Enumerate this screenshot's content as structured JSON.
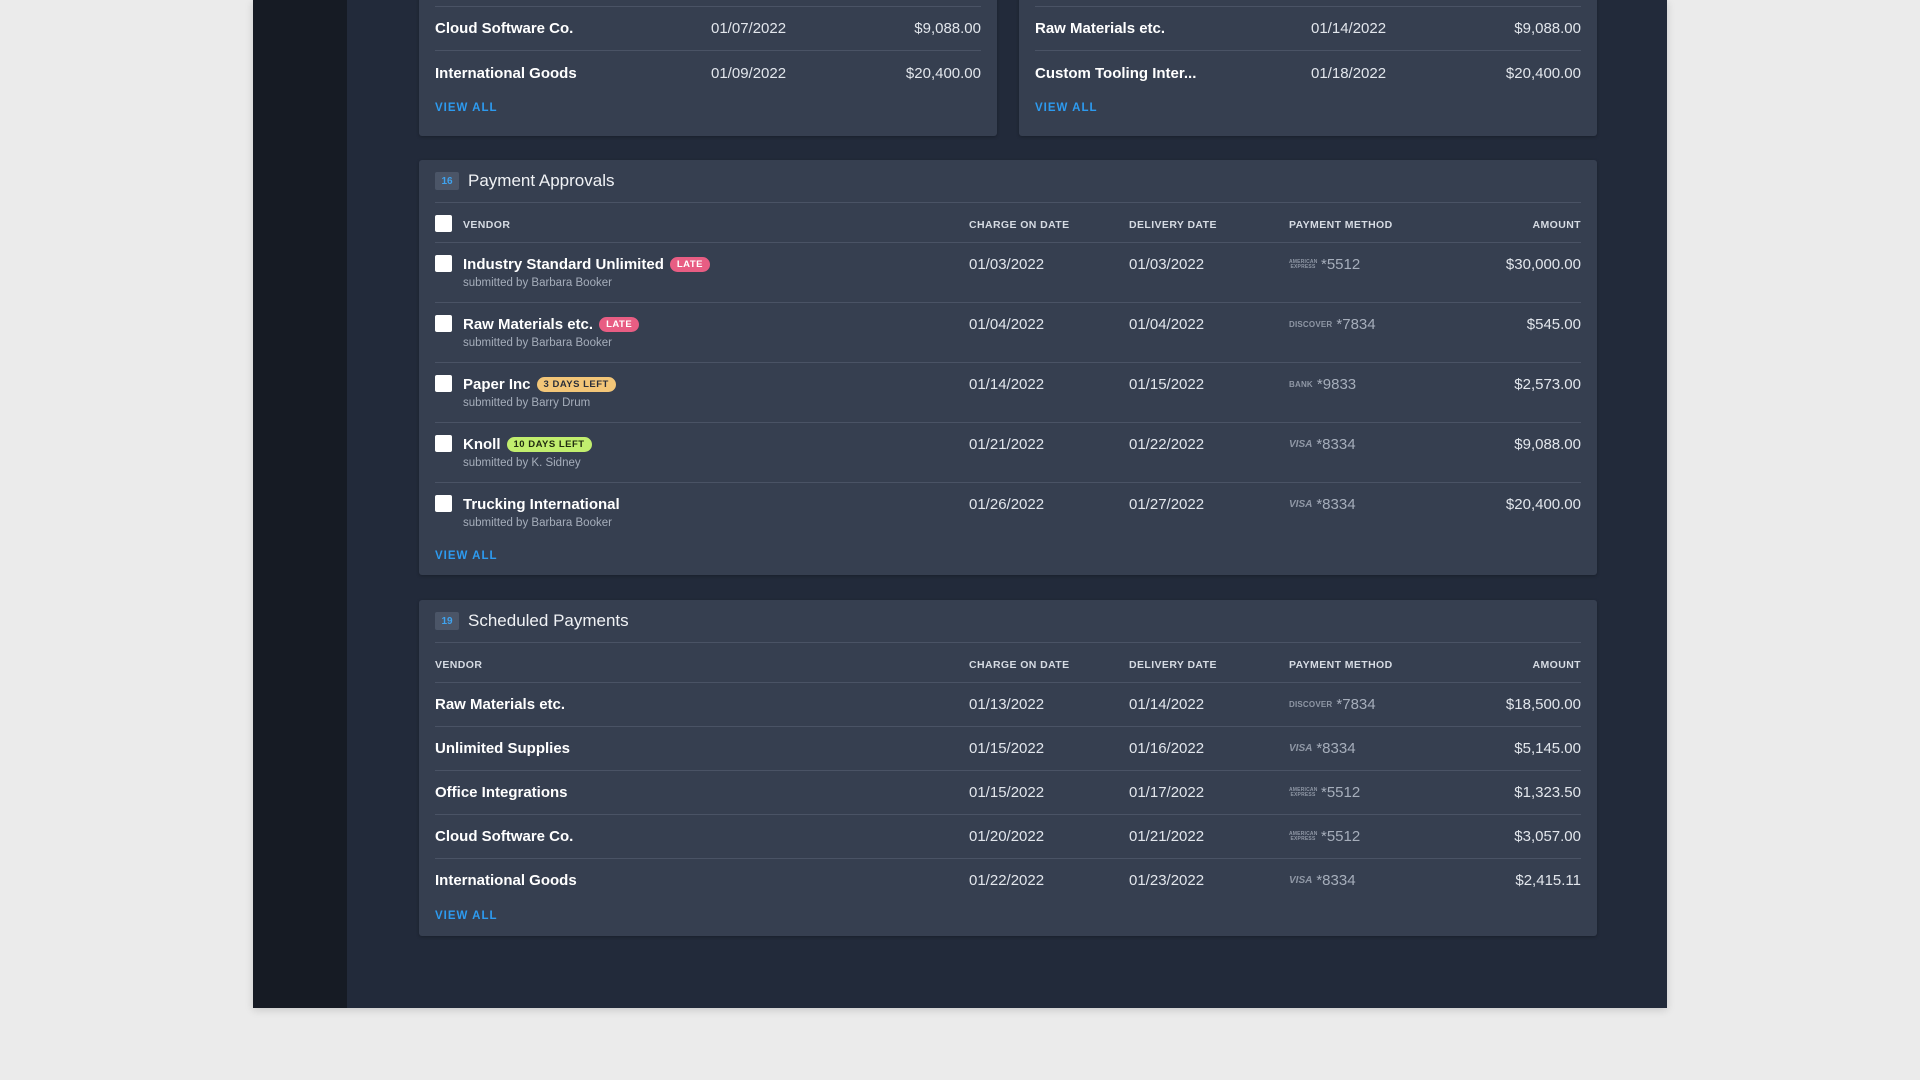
{
  "top_left_card": {
    "rows": [
      {
        "vendor": "Cloud Software Co.",
        "date": "01/07/2022",
        "amount": "$9,088.00"
      },
      {
        "vendor": "International Goods",
        "date": "01/09/2022",
        "amount": "$20,400.00"
      }
    ],
    "view_all": "VIEW ALL"
  },
  "top_right_card": {
    "rows": [
      {
        "vendor": "Raw Materials etc.",
        "date": "01/14/2022",
        "amount": "$9,088.00"
      },
      {
        "vendor": "Custom Tooling Inter...",
        "date": "01/18/2022",
        "amount": "$20,400.00"
      }
    ],
    "view_all": "VIEW ALL"
  },
  "payment_approvals": {
    "count": "16",
    "title": "Payment Approvals",
    "columns": {
      "vendor": "VENDOR",
      "charge_on_date": "CHARGE ON DATE",
      "delivery_date": "DELIVERY DATE",
      "payment_method": "PAYMENT METHOD",
      "amount": "AMOUNT"
    },
    "rows": [
      {
        "vendor": "Industry Standard Unlimited",
        "tag": "LATE",
        "tag_type": "late",
        "submitted_by": "submitted by Barbara Booker",
        "charge_on_date": "01/03/2022",
        "delivery_date": "01/03/2022",
        "method_logo": "AMERICAN EXPRESS",
        "method_icon": "amex-logo-icon",
        "method_suffix": "*5512",
        "amount": "$30,000.00"
      },
      {
        "vendor": "Raw Materials etc.",
        "tag": "LATE",
        "tag_type": "late",
        "submitted_by": "submitted by Barbara Booker",
        "charge_on_date": "01/04/2022",
        "delivery_date": "01/04/2022",
        "method_logo": "DISCOVER",
        "method_icon": "discover-logo-icon",
        "method_suffix": "*7834",
        "amount": "$545.00"
      },
      {
        "vendor": "Paper Inc",
        "tag": "3 DAYS LEFT",
        "tag_type": "soon",
        "submitted_by": "submitted by Barry Drum",
        "charge_on_date": "01/14/2022",
        "delivery_date": "01/15/2022",
        "method_logo": "BANK",
        "method_icon": "bank-icon",
        "method_suffix": "*9833",
        "amount": "$2,573.00"
      },
      {
        "vendor": "Knoll",
        "tag": "10 DAYS LEFT",
        "tag_type": "ok",
        "submitted_by": "submitted by K. Sidney",
        "charge_on_date": "01/21/2022",
        "delivery_date": "01/22/2022",
        "method_logo": "VISA",
        "method_icon": "visa-logo-icon",
        "method_suffix": "*8334",
        "amount": "$9,088.00"
      },
      {
        "vendor": "Trucking International",
        "tag": "",
        "tag_type": "",
        "submitted_by": "submitted by Barbara Booker",
        "charge_on_date": "01/26/2022",
        "delivery_date": "01/27/2022",
        "method_logo": "VISA",
        "method_icon": "visa-logo-icon",
        "method_suffix": "*8334",
        "amount": "$20,400.00"
      }
    ],
    "view_all": "VIEW ALL"
  },
  "scheduled_payments": {
    "count": "19",
    "title": "Scheduled Payments",
    "columns": {
      "vendor": "VENDOR",
      "charge_on_date": "CHARGE ON DATE",
      "delivery_date": "DELIVERY DATE",
      "payment_method": "PAYMENT METHOD",
      "amount": "AMOUNT"
    },
    "rows": [
      {
        "vendor": "Raw Materials etc.",
        "charge_on_date": "01/13/2022",
        "delivery_date": "01/14/2022",
        "method_logo": "DISCOVER",
        "method_icon": "discover-logo-icon",
        "method_suffix": "*7834",
        "amount": "$18,500.00"
      },
      {
        "vendor": "Unlimited Supplies",
        "charge_on_date": "01/15/2022",
        "delivery_date": "01/16/2022",
        "method_logo": "VISA",
        "method_icon": "visa-logo-icon",
        "method_suffix": "*8334",
        "amount": "$5,145.00"
      },
      {
        "vendor": "Office Integrations",
        "charge_on_date": "01/15/2022",
        "delivery_date": "01/17/2022",
        "method_logo": "AMERICAN EXPRESS",
        "method_icon": "amex-logo-icon",
        "method_suffix": "*5512",
        "amount": "$1,323.50"
      },
      {
        "vendor": "Cloud Software Co.",
        "charge_on_date": "01/20/2022",
        "delivery_date": "01/21/2022",
        "method_logo": "AMERICAN EXPRESS",
        "method_icon": "amex-logo-icon",
        "method_suffix": "*5512",
        "amount": "$3,057.00"
      },
      {
        "vendor": "International Goods",
        "charge_on_date": "01/22/2022",
        "delivery_date": "01/23/2022",
        "method_logo": "VISA",
        "method_icon": "visa-logo-icon",
        "method_suffix": "*8334",
        "amount": "$2,415.11"
      }
    ],
    "view_all": "VIEW ALL"
  }
}
